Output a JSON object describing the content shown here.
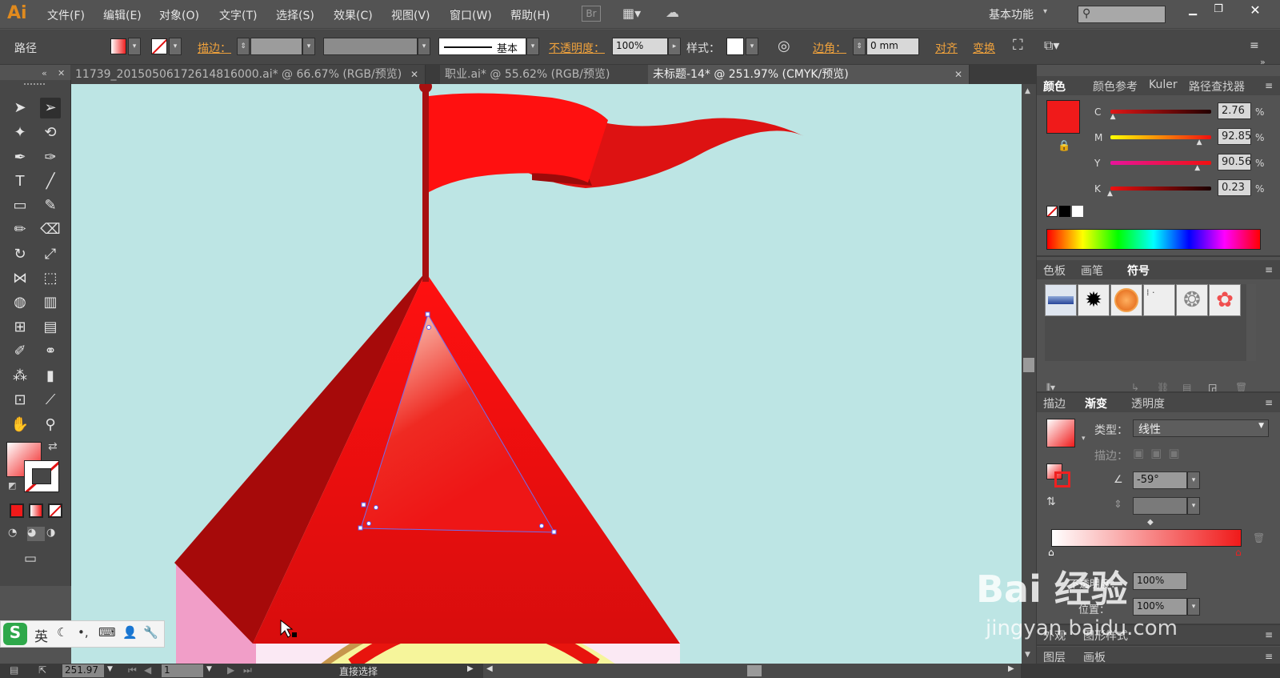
{
  "app": {
    "logo": "Ai"
  },
  "menu": [
    "文件(F)",
    "编辑(E)",
    "对象(O)",
    "文字(T)",
    "选择(S)",
    "效果(C)",
    "视图(V)",
    "窗口(W)",
    "帮助(H)"
  ],
  "menu_right": {
    "bridge": "Br",
    "workspace": "基本功能"
  },
  "control": {
    "object_type": "路径",
    "stroke_label": "描边：",
    "stroke_style": "基本",
    "opacity_label": "不透明度：",
    "opacity_value": "100%",
    "style_label": "样式：",
    "corner_label": "边角：",
    "corner_value": "0 mm",
    "align_label": "对齐",
    "transform_label": "变换"
  },
  "tabs": [
    {
      "label": "11739_20150506172614816000.ai* @ 66.67% (RGB/预览)",
      "active": false
    },
    {
      "label": "职业.ai* @ 55.62% (RGB/预览)",
      "active": false
    },
    {
      "label": "未标题-14* @ 251.97% (CMYK/预览)",
      "active": true
    }
  ],
  "panels": {
    "color": {
      "tabs": [
        "颜色",
        "颜色参考",
        "Kuler",
        "路径查找器"
      ],
      "channels": [
        {
          "name": "C",
          "value": "2.76",
          "level": 0.03
        },
        {
          "name": "M",
          "value": "92.85",
          "level": 0.93
        },
        {
          "name": "Y",
          "value": "90.56",
          "level": 0.91
        },
        {
          "name": "K",
          "value": "0.23",
          "level": 0.0
        }
      ],
      "unit": "%",
      "fill": "#f01a1a"
    },
    "swatches": {
      "tabs": [
        "色板",
        "画笔",
        "符号"
      ]
    },
    "gradient": {
      "tabs": [
        "描边",
        "渐变",
        "透明度"
      ],
      "type_label": "类型：",
      "type_value": "线性",
      "stroke_label": "描边：",
      "angle": "-59°",
      "opacity_label": "不透明度：",
      "opacity_value": "100%",
      "location_label": "位置：",
      "location_value": "100%"
    },
    "appearance": {
      "tabs": [
        "外观",
        "图形样式"
      ]
    },
    "layers": {
      "tabs": [
        "图层",
        "画板"
      ]
    }
  },
  "status": {
    "zoom": "251.97",
    "page": "1",
    "tool": "直接选择"
  },
  "ime": {
    "lang": "英"
  },
  "watermark": {
    "logo": "Bai 经验",
    "url": "jingyan.baidu.com"
  },
  "colors": {
    "accent_orange": "#f0a23c",
    "canvas_bg": "#bde5e4",
    "roof_red": "#e8140e",
    "flag_red": "#ff1010"
  }
}
